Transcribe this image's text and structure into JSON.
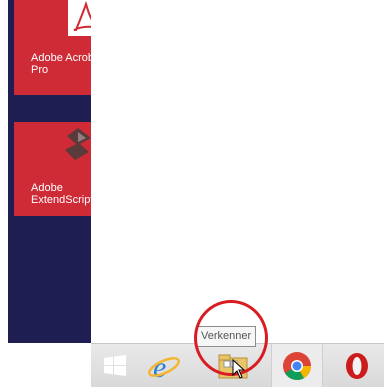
{
  "start_screen": {
    "tiles": [
      {
        "label": "Adobe Acrobat\nPro",
        "icon": "adobe-acrobat-icon",
        "color": "#cf2b36"
      },
      {
        "label": "Adobe\nExtendScript",
        "icon": "adobe-extendscript-icon",
        "color": "#cf2b36"
      }
    ],
    "background_color": "#1e1e52"
  },
  "taskbar": {
    "buttons": [
      {
        "name": "Start",
        "icon": "windows-logo-icon"
      },
      {
        "name": "Internet Explorer",
        "icon": "internet-explorer-icon"
      },
      {
        "name": "Verkenner",
        "icon": "file-explorer-icon"
      },
      {
        "name": "Google Chrome",
        "icon": "chrome-icon"
      },
      {
        "name": "Opera",
        "icon": "opera-icon"
      }
    ],
    "tooltip": "Verkenner"
  },
  "highlight_color": "#d91c22"
}
